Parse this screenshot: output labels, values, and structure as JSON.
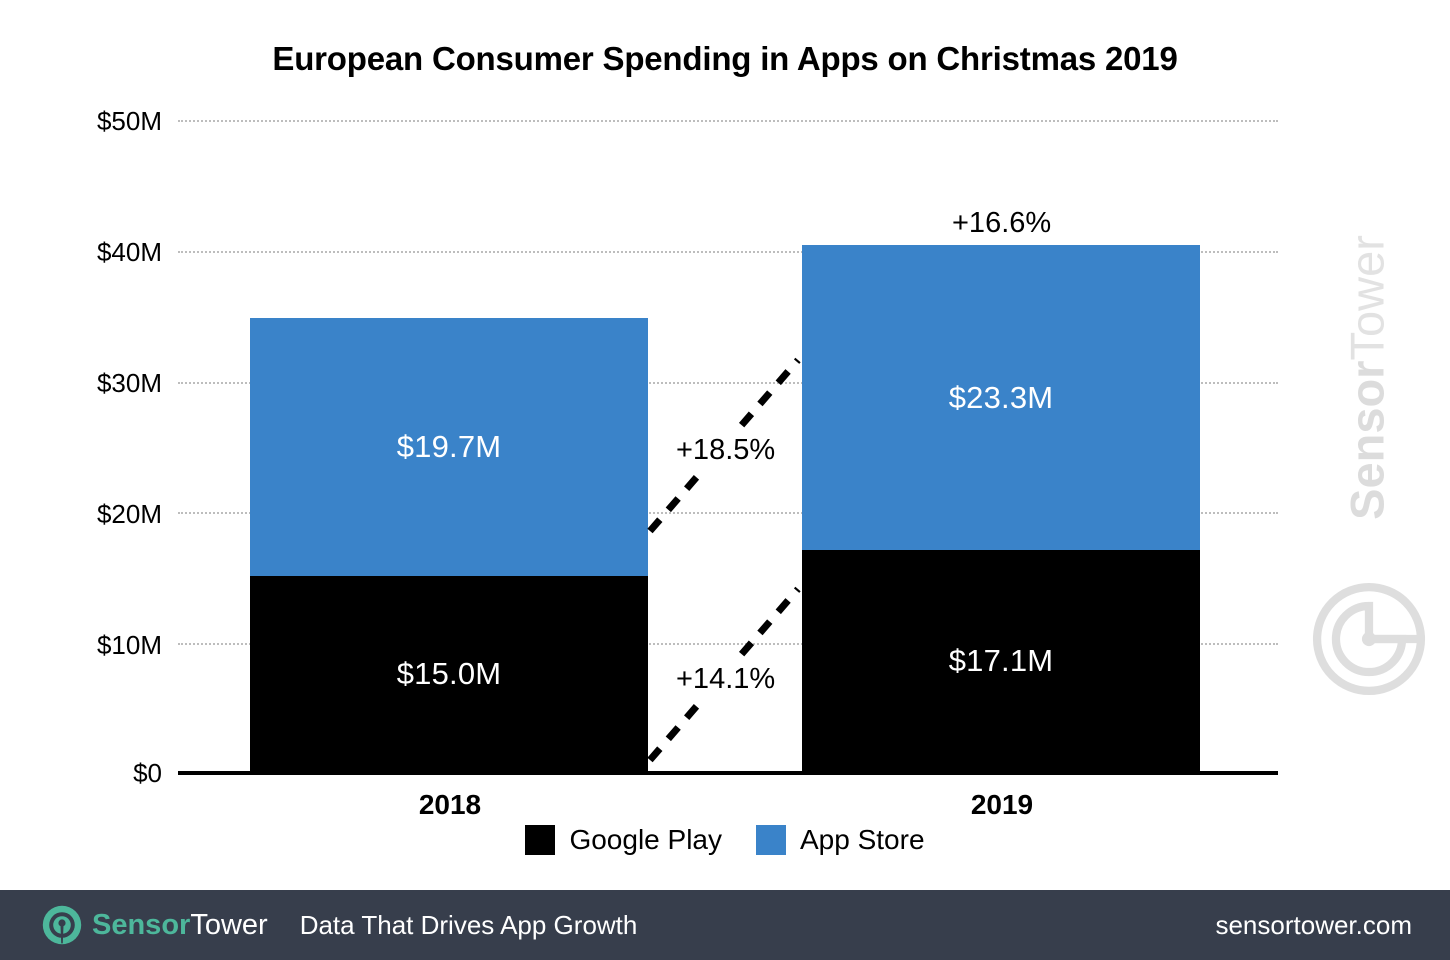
{
  "title": "European Consumer Spending in Apps on Christmas 2019",
  "watermark": {
    "bold_part": "Sensor",
    "light_part": "Tower",
    "mark_icon": "sensortower-circle-logo-icon"
  },
  "legend": {
    "items": [
      {
        "label": "Google Play",
        "color": "#000000"
      },
      {
        "label": "App Store",
        "color": "#3a83c9"
      }
    ]
  },
  "footer": {
    "logo_sensor": "Sensor",
    "logo_tower": "Tower",
    "tagline": "Data That Drives App Growth",
    "url": "sensortower.com",
    "background": "#373e4c",
    "accent": "#4db79b"
  },
  "chart_data": {
    "type": "bar",
    "stacked": true,
    "title": "European Consumer Spending in Apps on Christmas 2019",
    "xlabel": "",
    "ylabel": "",
    "categories": [
      "2018",
      "2019"
    ],
    "ylim": [
      0,
      50
    ],
    "yticks": [
      0,
      10,
      20,
      30,
      40,
      50
    ],
    "ytick_labels": [
      "$0",
      "$10M",
      "$20M",
      "$30M",
      "$40M",
      "$50M"
    ],
    "y_unit": "Millions USD",
    "grid": true,
    "legend_position": "bottom",
    "series": [
      {
        "name": "Google Play",
        "color": "#000000",
        "values": [
          15.0,
          17.1
        ],
        "value_labels": [
          "$15.0M",
          "$17.1M"
        ]
      },
      {
        "name": "App Store",
        "color": "#3a83c9",
        "values": [
          19.7,
          23.3
        ],
        "value_labels": [
          "$19.7M",
          "$23.3M"
        ]
      }
    ],
    "totals": [
      34.7,
      40.4
    ],
    "annotations": [
      {
        "name": "total-growth",
        "text": "+16.6%",
        "relates_to": "total"
      },
      {
        "name": "app-store-growth",
        "text": "+18.5%",
        "relates_to": "App Store"
      },
      {
        "name": "google-play-growth",
        "text": "+14.1%",
        "relates_to": "Google Play"
      }
    ]
  }
}
